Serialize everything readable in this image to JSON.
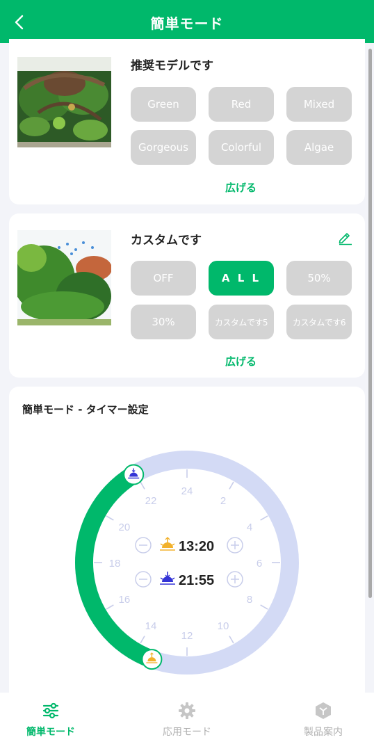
{
  "header": {
    "title": "簡単モード",
    "back_icon": "chevron-left-icon"
  },
  "recommended": {
    "title": "推奨モデルです",
    "buttons": [
      "Green",
      "Red",
      "Mixed",
      "Gorgeous",
      "Colorful",
      "Algae"
    ],
    "expand_label": "広げる"
  },
  "custom": {
    "title": "カスタムです",
    "edit_icon": "pencil-icon",
    "buttons": [
      "OFF",
      "A L L",
      "50%",
      "30%",
      "カスタムです5",
      "カスタムです6"
    ],
    "selected": "A L L",
    "expand_label": "広げる"
  },
  "timer": {
    "title": "簡単モード - タイマー設定",
    "hour_labels": [
      "24",
      "2",
      "4",
      "6",
      "8",
      "10",
      "12",
      "14",
      "16",
      "18",
      "20",
      "22"
    ],
    "sunrise_time": "13:20",
    "sunset_time": "21:55",
    "minus_icon": "minus-circle-icon",
    "plus_icon": "plus-circle-icon",
    "sunrise_icon": "sunrise-icon",
    "sunset_icon": "sunset-icon"
  },
  "colors": {
    "accent": "#00b86b",
    "inactive_button": "#d4d4d4",
    "ring_off": "#d3daf5",
    "tick": "#c8cdea"
  },
  "tabbar": {
    "items": [
      {
        "label": "簡単モード",
        "icon": "sliders-icon",
        "active": true
      },
      {
        "label": "応用モード",
        "icon": "gear-icon",
        "active": false
      },
      {
        "label": "製品案内",
        "icon": "cube-icon",
        "active": false
      }
    ]
  }
}
